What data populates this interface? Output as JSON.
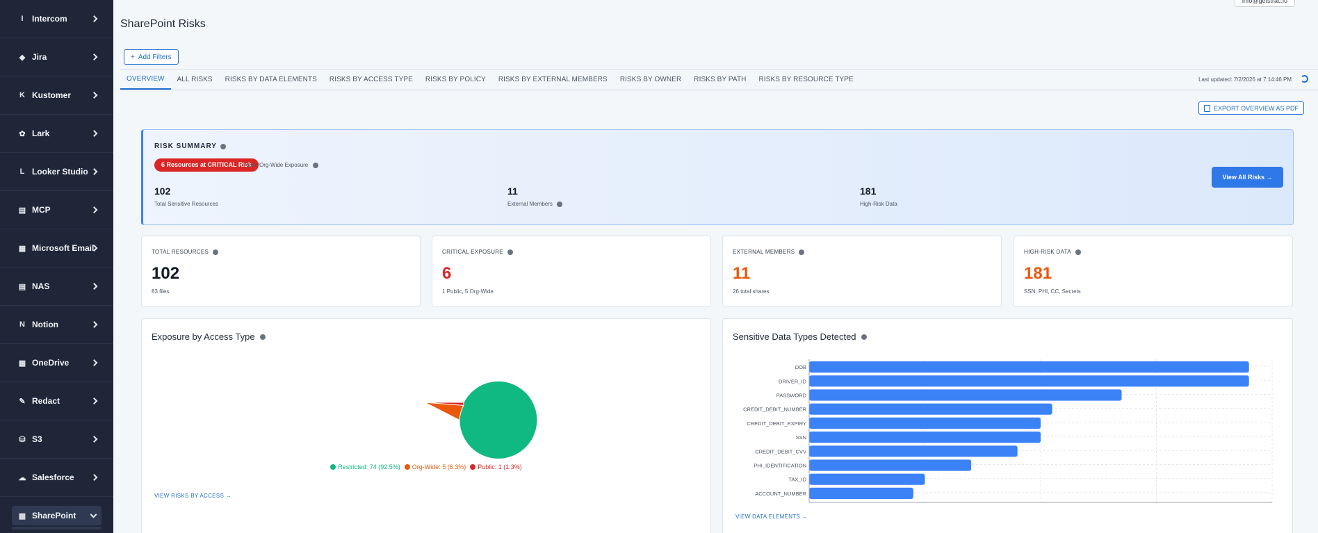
{
  "sidebar": {
    "items": [
      {
        "icon": "I",
        "icon_name": "intercom-icon",
        "label": "Intercom"
      },
      {
        "icon": "◆",
        "icon_name": "jira-icon",
        "label": "Jira"
      },
      {
        "icon": "K",
        "icon_name": "kustomer-icon",
        "label": "Kustomer"
      },
      {
        "icon": "✿",
        "icon_name": "lark-icon",
        "label": "Lark"
      },
      {
        "icon": "L",
        "icon_name": "looker-studio-icon",
        "label": "Looker Studio"
      },
      {
        "icon": "▤",
        "icon_name": "mcp-icon",
        "label": "MCP"
      },
      {
        "icon": "▦",
        "icon_name": "microsoft-email-icon",
        "label": "Microsoft Email"
      },
      {
        "icon": "▤",
        "icon_name": "nas-icon",
        "label": "NAS"
      },
      {
        "icon": "N",
        "icon_name": "notion-icon",
        "label": "Notion"
      },
      {
        "icon": "▦",
        "icon_name": "onedrive-icon",
        "label": "OneDrive"
      },
      {
        "icon": "✎",
        "icon_name": "redact-icon",
        "label": "Redact"
      },
      {
        "icon": "⛁",
        "icon_name": "s3-icon",
        "label": "S3"
      },
      {
        "icon": "☁",
        "icon_name": "salesforce-icon",
        "label": "Salesforce"
      }
    ],
    "active": {
      "icon": "▦",
      "icon_name": "sharepoint-icon",
      "label": "SharePoint"
    }
  },
  "header": {
    "title": "SharePoint Risks",
    "user_email": "info@getstrac.io",
    "add_filters": "Add Filters",
    "last_updated": "Last updated: 7/2/2026 at 7:14:46 PM",
    "export": "EXPORT OVERVIEW AS PDF"
  },
  "tabs": [
    "OVERVIEW",
    "ALL RISKS",
    "RISKS BY DATA ELEMENTS",
    "RISKS BY ACCESS TYPE",
    "RISKS BY POLICY",
    "RISKS BY EXTERNAL MEMBERS",
    "RISKS BY OWNER",
    "RISKS BY PATH",
    "RISKS BY RESOURCE TYPE"
  ],
  "risk_summary": {
    "title": "RISK SUMMARY",
    "badge": "6 Resources at CRITICAL Risk",
    "exposure": "Public/Org-Wide Exposure",
    "stats": [
      {
        "value": "102",
        "label": "Total Sensitive Resources"
      },
      {
        "value": "11",
        "label": "External Members"
      },
      {
        "value": "181",
        "label": "High-Risk Data"
      }
    ],
    "view_all": "View All Risks →"
  },
  "cards": [
    {
      "title": "TOTAL RESOURCES",
      "value": "102",
      "sub": "83 files",
      "color": "#111827"
    },
    {
      "title": "CRITICAL EXPOSURE",
      "value": "6",
      "sub": "1 Public, 5 Org-Wide",
      "color": "#dc2626"
    },
    {
      "title": "EXTERNAL MEMBERS",
      "value": "11",
      "sub": "26 total shares",
      "color": "#ea580c"
    },
    {
      "title": "HIGH-RISK DATA",
      "value": "181",
      "sub": "SSN, PHI, CC, Secrets",
      "color": "#ea580c"
    }
  ],
  "exposure_panel": {
    "title": "Exposure by Access Type",
    "link": "VIEW RISKS BY ACCESS →",
    "legend": [
      {
        "label": "Restricted: 74 (92.5%)",
        "color": "#10b981"
      },
      {
        "label": "Org-Wide: 5 (6.3%)",
        "color": "#ea580c"
      },
      {
        "label": "Public: 1 (1.3%)",
        "color": "#dc2626"
      }
    ]
  },
  "sensitive_panel": {
    "title": "Sensitive Data Types Detected",
    "link": "VIEW DATA ELEMENTS →"
  },
  "chart_data": [
    {
      "type": "pie",
      "title": "Exposure by Access Type",
      "series": [
        {
          "name": "Restricted",
          "value": 74,
          "color": "#10b981"
        },
        {
          "name": "Org-Wide",
          "value": 5,
          "color": "#ea580c"
        },
        {
          "name": "Public",
          "value": 1,
          "color": "#dc2626"
        }
      ]
    },
    {
      "type": "bar",
      "orientation": "horizontal",
      "title": "Sensitive Data Types Detected",
      "categories": [
        "DOB",
        "DRIVER_ID",
        "PASSWORD",
        "CREDIT_DEBIT_NUMBER",
        "CREDIT_DEBIT_EXPIRY",
        "SSN",
        "CREDIT_DEBIT_CVV",
        "PHI_IDENTIFICATION",
        "TAX_ID",
        "ACCOUNT_NUMBER"
      ],
      "values": [
        38,
        38,
        27,
        21,
        20,
        20,
        18,
        14,
        10,
        9
      ],
      "xlim": [
        0,
        40
      ],
      "xticks": [
        0,
        10,
        20,
        30,
        40
      ],
      "color": "#3b82f6",
      "grid": true
    }
  ]
}
